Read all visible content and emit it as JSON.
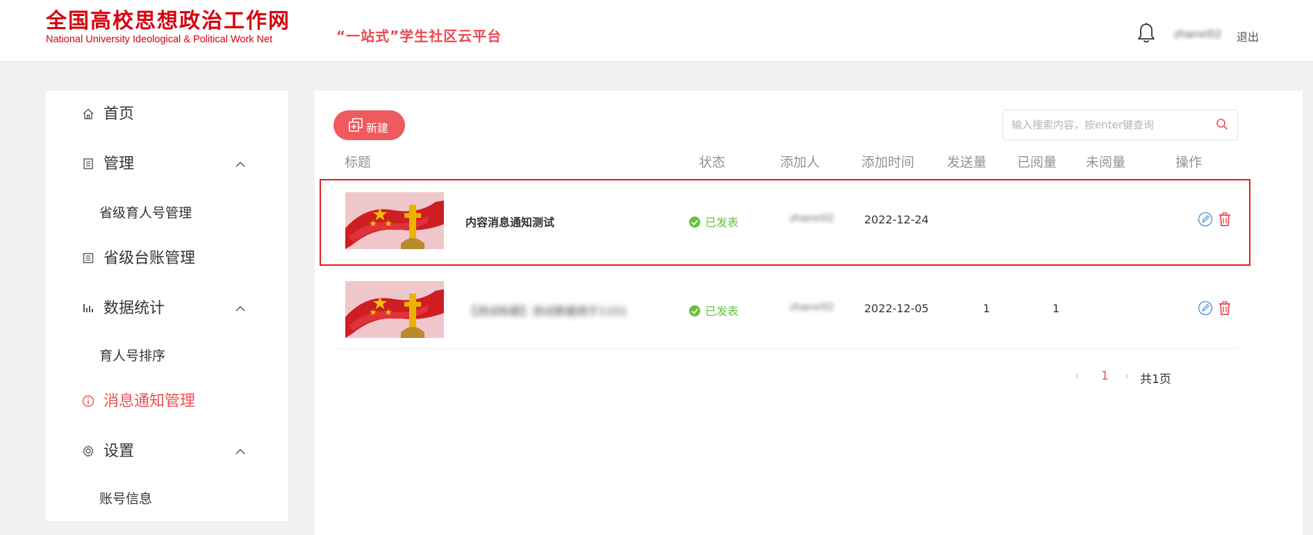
{
  "header": {
    "logo_cn": "全国高校思想政治工作网",
    "logo_en": "National University Ideological & Political Work Net",
    "platform_title": "“一站式”学生社区云平台",
    "username": "zhanxi02",
    "logout_label": "退出"
  },
  "sidebar": {
    "home": "首页",
    "manage": "管理",
    "manage_sub": "省级育人号管理",
    "ledger": "省级台账管理",
    "stats": "数据统计",
    "stats_sub": "育人号排序",
    "message": "消息通知管理",
    "settings": "设置",
    "settings_sub": "账号信息"
  },
  "toolbar": {
    "new_label": "新建",
    "search_placeholder": "输入搜索内容，按enter键查询"
  },
  "table": {
    "columns": [
      "标题",
      "状态",
      "添加人",
      "添加时间",
      "发送量",
      "已阅量",
      "未阅量",
      "操作"
    ],
    "rows": [
      {
        "title": "内容消息通知测试",
        "status": "已发表",
        "adder": "zhanxi02",
        "date": "2022-12-24",
        "sent": "",
        "read": "",
        "unread": ""
      },
      {
        "title": "【测试标题】测试数据用于1101",
        "status": "已发表",
        "adder": "zhanxi02",
        "date": "2022-12-05",
        "sent": "1",
        "read": "1",
        "unread": ""
      }
    ]
  },
  "pagination": {
    "prev": "‹",
    "current": "1",
    "next": "›",
    "total": "共1页"
  },
  "colors": {
    "brand_red": "#d7000f",
    "accent": "#ef5a5e",
    "status_green": "#67c23a",
    "highlight": "#e01b24"
  }
}
